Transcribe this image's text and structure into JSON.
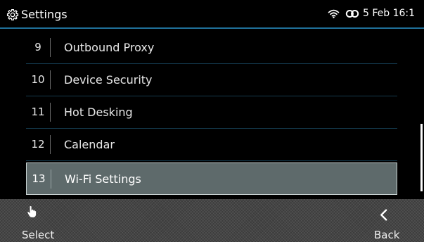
{
  "header": {
    "title": "Settings",
    "status_text": "5 Feb 16:1",
    "icons": [
      "gear-icon",
      "wifi-icon",
      "link-icon"
    ]
  },
  "menu": {
    "items": [
      {
        "number": "9",
        "label": "Outbound Proxy",
        "selected": false
      },
      {
        "number": "10",
        "label": "Device Security",
        "selected": false
      },
      {
        "number": "11",
        "label": "Hot Desking",
        "selected": false
      },
      {
        "number": "12",
        "label": "Calendar",
        "selected": false
      },
      {
        "number": "13",
        "label": "Wi-Fi Settings",
        "selected": true
      }
    ]
  },
  "softkeys": {
    "select_label": "Select",
    "back_label": "Back",
    "icons": [
      "hand-pointer-icon",
      "chevron-left-icon"
    ]
  },
  "colors": {
    "accent_line": "#1f6f99",
    "selected_row": "#5e6a6b",
    "row_divider": "#143a4e"
  }
}
